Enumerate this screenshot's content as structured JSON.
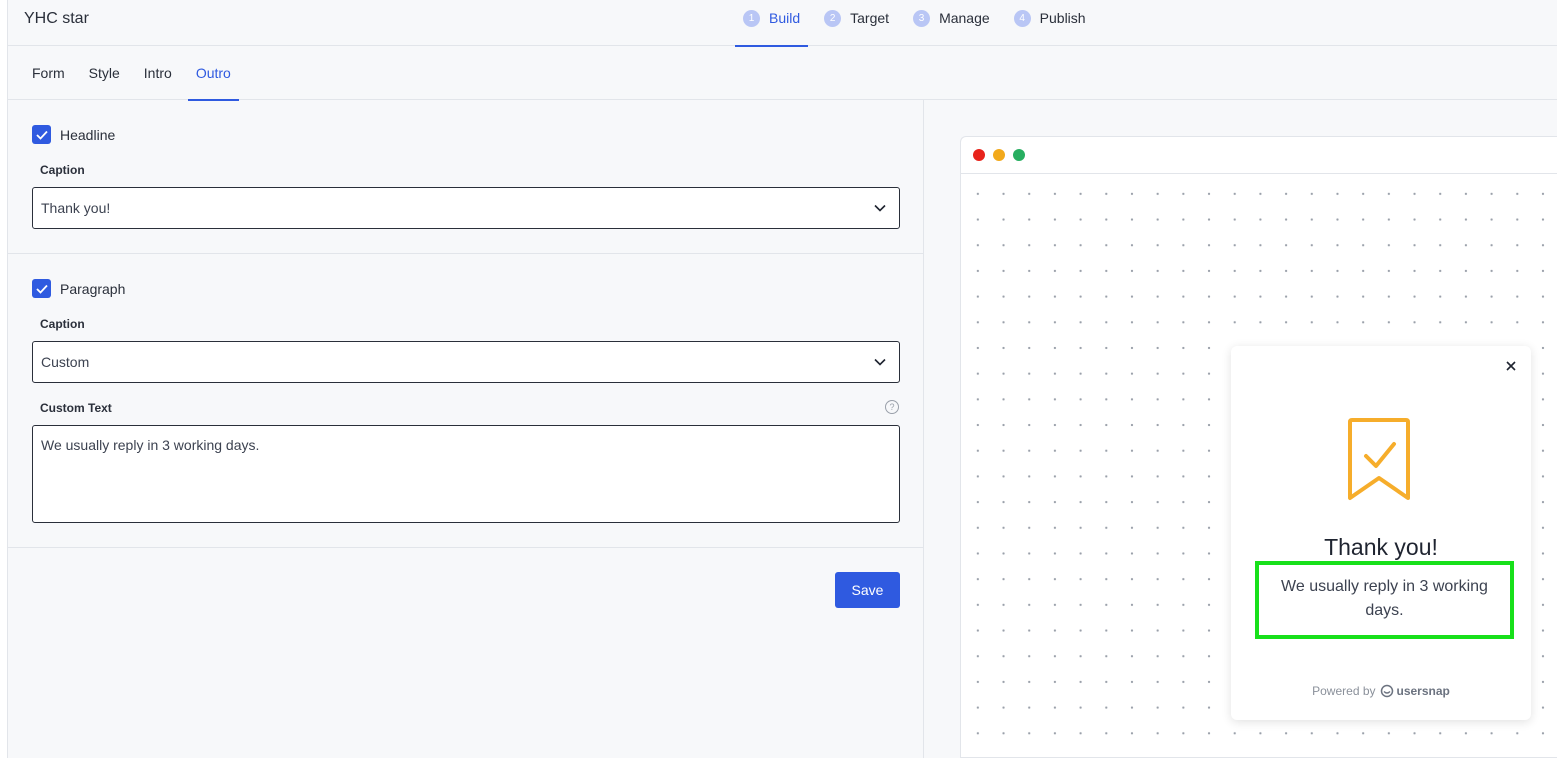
{
  "app": {
    "title": "YHC star"
  },
  "steps": [
    {
      "num": "1",
      "label": "Build",
      "active": true
    },
    {
      "num": "2",
      "label": "Target"
    },
    {
      "num": "3",
      "label": "Manage"
    },
    {
      "num": "4",
      "label": "Publish"
    }
  ],
  "tabs": [
    {
      "label": "Form"
    },
    {
      "label": "Style"
    },
    {
      "label": "Intro"
    },
    {
      "label": "Outro",
      "active": true
    }
  ],
  "headline": {
    "checkbox_label": "Headline",
    "checked": true,
    "caption_label": "Caption",
    "caption_value": "Thank you!"
  },
  "paragraph": {
    "checkbox_label": "Paragraph",
    "checked": true,
    "caption_label": "Caption",
    "caption_value": "Custom",
    "custom_text_label": "Custom Text",
    "help_glyph": "?",
    "custom_text_value": "We usually reply in 3 working days."
  },
  "save_label": "Save",
  "preview": {
    "window_dots": [
      "#e8231b",
      "#f2a91b",
      "#27ae60"
    ],
    "widget": {
      "title": "Thank you!",
      "text": "We usually reply in 3 working days.",
      "powered_by": "Powered by",
      "brand": "usersnap",
      "icon": "ribbon-check-icon",
      "icon_color": "#f6ad2b"
    }
  },
  "colors": {
    "accent": "#2f5ae0",
    "highlight_border": "#17e01a"
  }
}
